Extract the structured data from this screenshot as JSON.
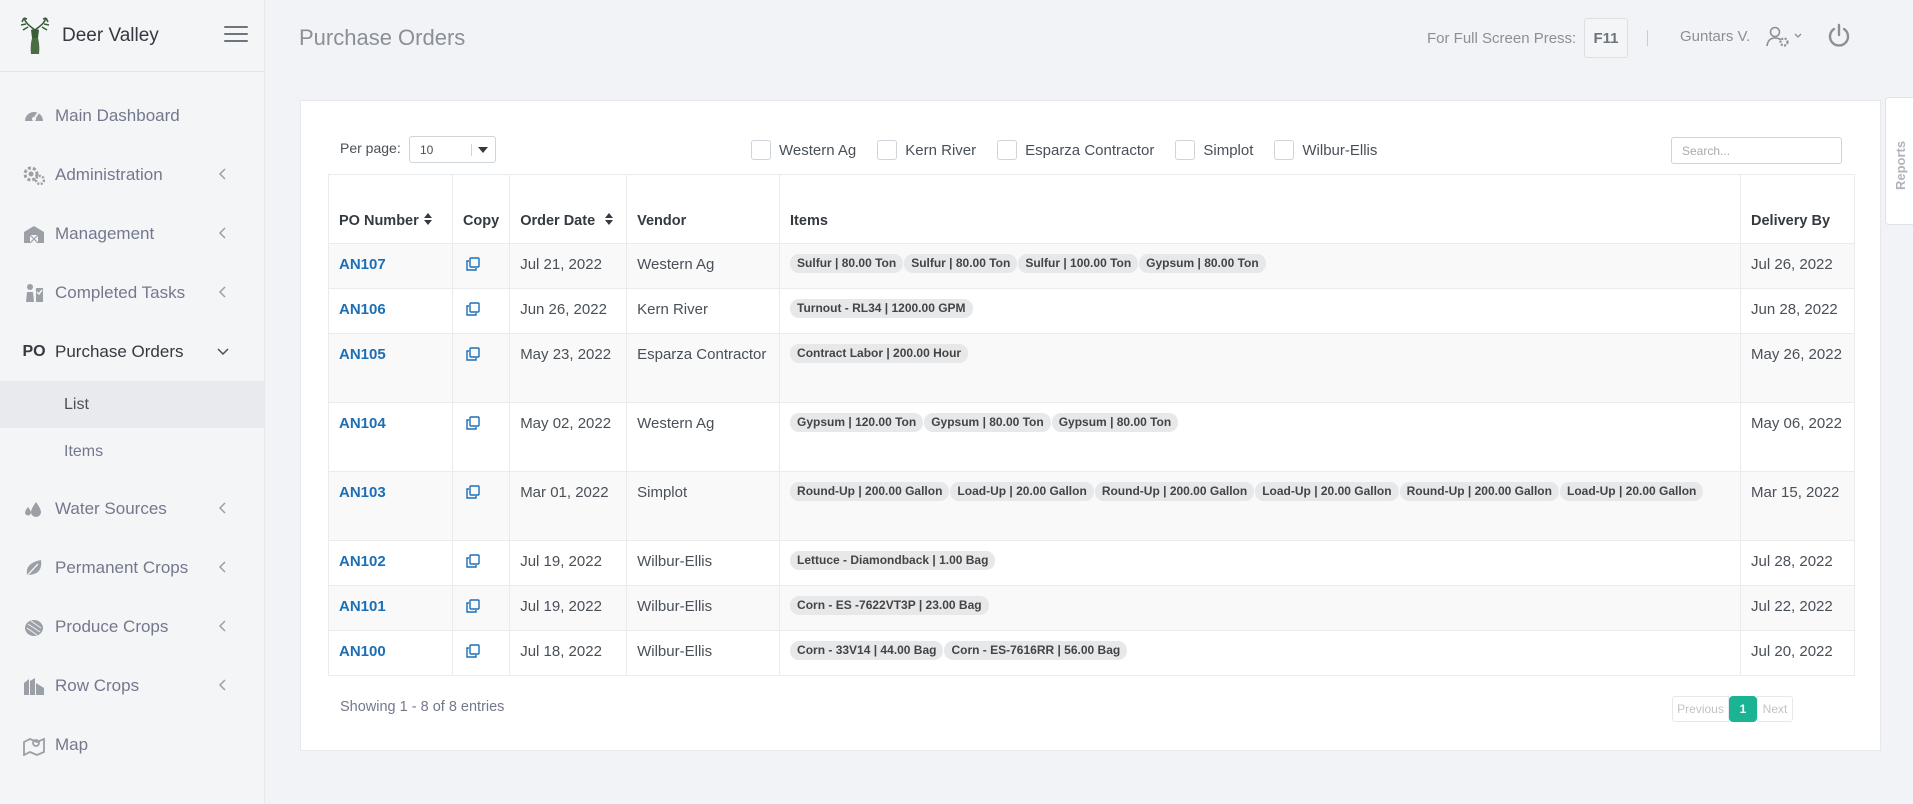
{
  "brand": {
    "name": "Deer Valley"
  },
  "sidebar": {
    "items": [
      {
        "label": "Main Dashboard",
        "icon": "dashboard-icon"
      },
      {
        "label": "Administration",
        "icon": "gears-icon"
      },
      {
        "label": "Management",
        "icon": "barn-icon"
      },
      {
        "label": "Completed Tasks",
        "icon": "tasks-icon"
      },
      {
        "label": "Purchase Orders",
        "icon": "po-icon",
        "prefix": "PO"
      },
      {
        "label": "Water Sources",
        "icon": "water-drops-icon"
      },
      {
        "label": "Permanent Crops",
        "icon": "leaf-icon"
      },
      {
        "label": "Produce Crops",
        "icon": "produce-icon"
      },
      {
        "label": "Row Crops",
        "icon": "row-crops-icon"
      },
      {
        "label": "Map",
        "icon": "map-icon"
      }
    ],
    "po_sub": [
      "List",
      "Items"
    ]
  },
  "header": {
    "title": "Purchase Orders",
    "fullscreen_text": "For Full Screen Press:",
    "fullscreen_key": "F11",
    "user": "Guntars V."
  },
  "reports_tab": "Reports",
  "toolbar": {
    "per_page_label": "Per page:",
    "per_page_value": "10",
    "search_placeholder": "Search..."
  },
  "filters": [
    "Western Ag",
    "Kern River",
    "Esparza Contractor",
    "Simplot",
    "Wilbur-Ellis"
  ],
  "table": {
    "headers": [
      "PO Number",
      "Copy",
      "Order Date",
      "Vendor",
      "Items",
      "Delivery By"
    ],
    "rows": [
      {
        "po": "AN107",
        "date": "Jul 21, 2022",
        "vendor": "Western Ag",
        "items": [
          "Sulfur | 80.00 Ton",
          "Sulfur | 80.00 Ton",
          "Sulfur | 100.00 Ton",
          "Gypsum | 80.00 Ton"
        ],
        "delivery": "Jul 26, 2022"
      },
      {
        "po": "AN106",
        "date": "Jun 26, 2022",
        "vendor": "Kern River",
        "items": [
          "Turnout - RL34 | 1200.00 GPM"
        ],
        "delivery": "Jun 28, 2022"
      },
      {
        "po": "AN105",
        "date": "May 23, 2022",
        "vendor": "Esparza Contractor",
        "items": [
          "Contract Labor | 200.00 Hour"
        ],
        "delivery": "May 26, 2022"
      },
      {
        "po": "AN104",
        "date": "May 02, 2022",
        "vendor": "Western Ag",
        "items": [
          "Gypsum | 120.00 Ton",
          "Gypsum | 80.00 Ton",
          "Gypsum | 80.00 Ton"
        ],
        "delivery": "May 06, 2022"
      },
      {
        "po": "AN103",
        "date": "Mar 01, 2022",
        "vendor": "Simplot",
        "items": [
          "Round-Up | 200.00 Gallon",
          "Load-Up | 20.00 Gallon",
          "Round-Up | 200.00 Gallon",
          "Load-Up | 20.00 Gallon",
          "Round-Up | 200.00 Gallon",
          "Load-Up | 20.00 Gallon"
        ],
        "delivery": "Mar 15, 2022"
      },
      {
        "po": "AN102",
        "date": "Jul 19, 2022",
        "vendor": "Wilbur-Ellis",
        "items": [
          "Lettuce - Diamondback | 1.00 Bag"
        ],
        "delivery": "Jul 28, 2022"
      },
      {
        "po": "AN101",
        "date": "Jul 19, 2022",
        "vendor": "Wilbur-Ellis",
        "items": [
          "Corn - ES -7622VT3P | 23.00 Bag"
        ],
        "delivery": "Jul 22, 2022"
      },
      {
        "po": "AN100",
        "date": "Jul 18, 2022",
        "vendor": "Wilbur-Ellis",
        "items": [
          "Corn - 33V14 | 44.00 Bag",
          "Corn - ES-7616RR | 56.00 Bag"
        ],
        "delivery": "Jul 20, 2022"
      }
    ]
  },
  "footer": {
    "showing": "Showing 1 - 8 of 8 entries",
    "prev": "Previous",
    "page": "1",
    "next": "Next"
  },
  "colors": {
    "link": "#1c6fb5",
    "accent": "#1ab394"
  }
}
